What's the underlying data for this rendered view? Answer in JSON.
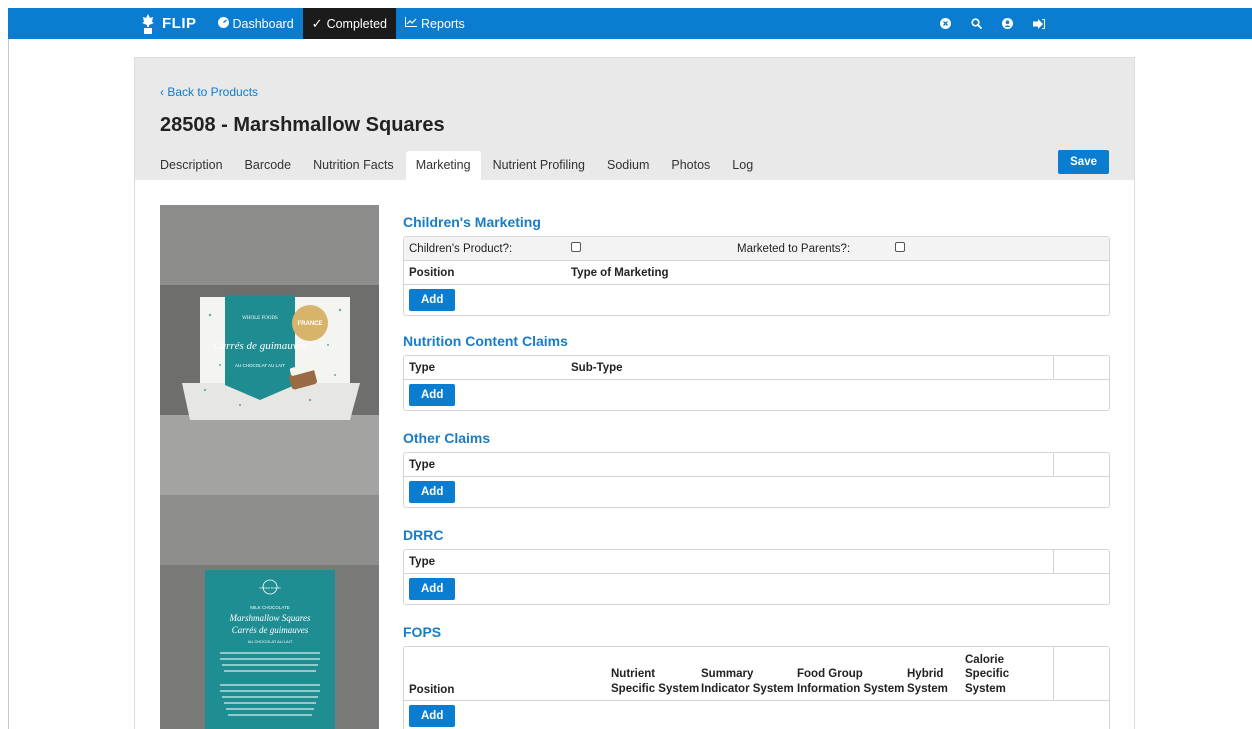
{
  "nav": {
    "brand": "FLIP",
    "items": [
      {
        "icon": "dashboard-icon",
        "label": "Dashboard"
      },
      {
        "icon": "check-icon",
        "label": "Completed"
      },
      {
        "icon": "chart-icon",
        "label": "Reports"
      }
    ],
    "right_icons": [
      "close-circle-icon",
      "search-icon",
      "user-icon",
      "sign-out-icon"
    ]
  },
  "header": {
    "back_link": "‹ Back to Products",
    "title": "28508 - Marshmallow Squares",
    "tabs": [
      "Description",
      "Barcode",
      "Nutrition Facts",
      "Marketing",
      "Nutrient Profiling",
      "Sodium",
      "Photos",
      "Log"
    ],
    "active_tab": "Marketing",
    "save_label": "Save"
  },
  "photo1": {
    "brand": "WHOLE FOODS",
    "name": "Carrés de guimauves",
    "sub": "AU CHOCOLAT AU LAIT",
    "seal": "FRANCE"
  },
  "photo2": {
    "brand": "WHOLE FOODS",
    "kicker": "MILK CHOCOLATE",
    "name_en": "Marshmallow Squares",
    "name_fr": "Carrés de guimauves",
    "sub": "AU CHOCOLAT AU LAIT"
  },
  "sections": {
    "childrens": {
      "title": "Children's Marketing",
      "childrens_product_label": "Children's Product?:",
      "marketed_parents_label": "Marketed to Parents?:",
      "col_position": "Position",
      "col_type": "Type of Marketing",
      "add": "Add"
    },
    "ncc": {
      "title": "Nutrition Content Claims",
      "col_type": "Type",
      "col_subtype": "Sub-Type",
      "add": "Add"
    },
    "other": {
      "title": "Other Claims",
      "col_type": "Type",
      "add": "Add"
    },
    "drrc": {
      "title": "DRRC",
      "col_type": "Type",
      "add": "Add"
    },
    "fops": {
      "title": "FOPS",
      "col_position": "Position",
      "col_nutrient": "Nutrient Specific System",
      "col_summary": "Summary Indicator System",
      "col_food": "Food Group Information System",
      "col_hybrid": "Hybrid System",
      "col_calorie": "Calorie Specific System",
      "add": "Add"
    }
  },
  "colors": {
    "primary": "#0b7dd1",
    "section_title": "#1a7cc6",
    "header_bg": "#e9e9e9",
    "active_nav": "#1b1b1b"
  }
}
